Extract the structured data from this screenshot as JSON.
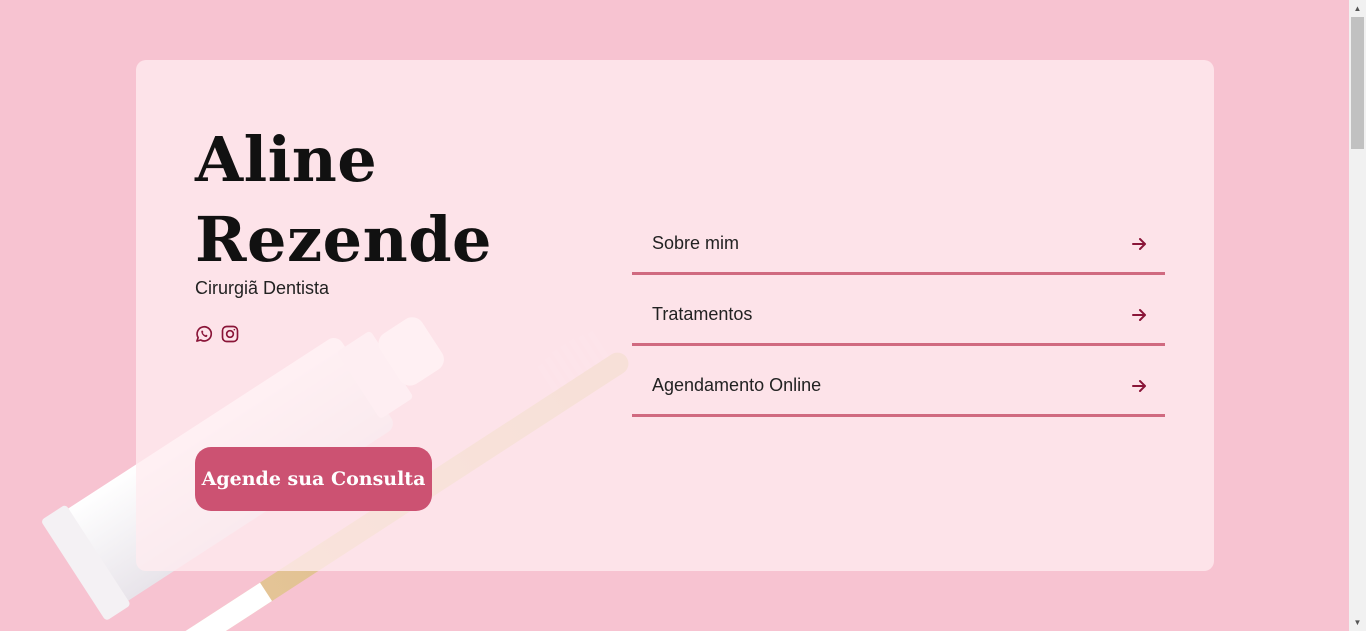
{
  "hero": {
    "name_line1": "Aline",
    "name_line2": "Rezende",
    "subtitle": "Cirurgiã Dentista",
    "cta_label": "Agende sua Consulta"
  },
  "socials": [
    {
      "icon": "whatsapp-icon"
    },
    {
      "icon": "instagram-icon"
    }
  ],
  "menu": {
    "items": [
      {
        "label": "Sobre mim",
        "icon": "arrow-right-icon"
      },
      {
        "label": "Tratamentos",
        "icon": "arrow-right-icon"
      },
      {
        "label": "Agendamento Online",
        "icon": "arrow-right-icon"
      }
    ]
  },
  "colors": {
    "background": "#f7c3d1",
    "accent": "#cc5272",
    "divider": "#d06a80",
    "arrow": "#8a1538"
  }
}
